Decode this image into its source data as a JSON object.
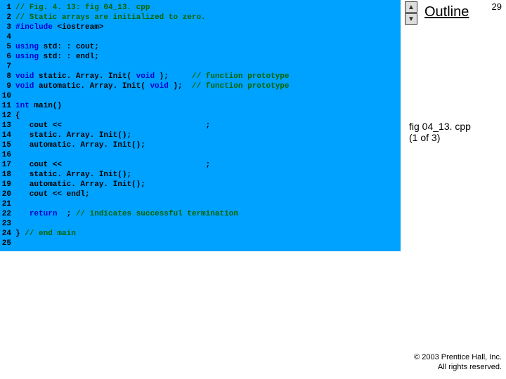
{
  "page_number": "29",
  "outline_label": "Outline",
  "file_label_line1": "fig 04_13. cpp",
  "file_label_line2": "(1 of 3)",
  "copyright_line1": "© 2003 Prentice Hall, Inc.",
  "copyright_line2": "All rights reserved.",
  "arrow_up": "▲",
  "arrow_down": "▼",
  "code": [
    {
      "n": "1",
      "segs": [
        [
          "comment",
          "// Fig. 4. 13: fig 04_13. cpp"
        ]
      ]
    },
    {
      "n": "2",
      "segs": [
        [
          "comment",
          "// Static arrays are initialized to zero."
        ]
      ]
    },
    {
      "n": "3",
      "segs": [
        [
          "preproc",
          "#include "
        ],
        [
          "angled",
          "<iostream>"
        ]
      ]
    },
    {
      "n": "4",
      "segs": []
    },
    {
      "n": "5",
      "segs": [
        [
          "keyword",
          "using "
        ],
        [
          "plain",
          "std: : cout;"
        ]
      ]
    },
    {
      "n": "6",
      "segs": [
        [
          "keyword",
          "using "
        ],
        [
          "plain",
          "std: : endl;"
        ]
      ]
    },
    {
      "n": "7",
      "segs": []
    },
    {
      "n": "8",
      "segs": [
        [
          "keyword",
          "void "
        ],
        [
          "plain",
          "static. Array. Init( "
        ],
        [
          "keyword",
          "void"
        ],
        [
          "plain",
          " );     "
        ],
        [
          "comment",
          "// function prototype"
        ]
      ]
    },
    {
      "n": "9",
      "segs": [
        [
          "keyword",
          "void "
        ],
        [
          "plain",
          "automatic. Array. Init( "
        ],
        [
          "keyword",
          "void"
        ],
        [
          "plain",
          " );  "
        ],
        [
          "comment",
          "// function prototype"
        ]
      ]
    },
    {
      "n": "10",
      "segs": []
    },
    {
      "n": "11",
      "segs": [
        [
          "keyword",
          "int "
        ],
        [
          "plain",
          "main()"
        ]
      ]
    },
    {
      "n": "12",
      "segs": [
        [
          "plain",
          "{"
        ]
      ]
    },
    {
      "n": "13",
      "segs": [
        [
          "plain",
          "   cout <<                               ;"
        ]
      ]
    },
    {
      "n": "14",
      "segs": [
        [
          "plain",
          "   static. Array. Init();"
        ]
      ]
    },
    {
      "n": "15",
      "segs": [
        [
          "plain",
          "   automatic. Array. Init();"
        ]
      ]
    },
    {
      "n": "16",
      "segs": []
    },
    {
      "n": "17",
      "segs": [
        [
          "plain",
          "   cout <<                               ;"
        ]
      ]
    },
    {
      "n": "18",
      "segs": [
        [
          "plain",
          "   static. Array. Init();"
        ]
      ]
    },
    {
      "n": "19",
      "segs": [
        [
          "plain",
          "   automatic. Array. Init();"
        ]
      ]
    },
    {
      "n": "20",
      "segs": [
        [
          "plain",
          "   cout << endl;"
        ]
      ]
    },
    {
      "n": "21",
      "segs": []
    },
    {
      "n": "22",
      "segs": [
        [
          "plain",
          "   "
        ],
        [
          "keyword",
          "return  "
        ],
        [
          "plain",
          "; "
        ],
        [
          "comment",
          "// indicates successful termination"
        ]
      ]
    },
    {
      "n": "23",
      "segs": []
    },
    {
      "n": "24",
      "segs": [
        [
          "plain",
          "} "
        ],
        [
          "comment",
          "// end main"
        ]
      ]
    },
    {
      "n": "25",
      "segs": []
    }
  ]
}
